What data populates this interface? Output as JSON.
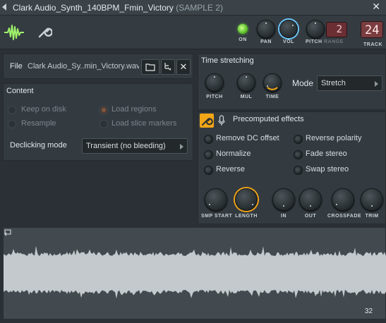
{
  "window": {
    "title": "Clark Audio_Synth_140BPM_Fmin_Victory",
    "subtitle": "(SAMPLE 2)"
  },
  "toolbar": {
    "on_label": "ON",
    "pan_label": "PAN",
    "vol_label": "VOL",
    "pitch_label": "PITCH",
    "range_label": "RANGE",
    "range_value": "2",
    "track_label": "TRACK",
    "track_value": "24"
  },
  "file": {
    "label": "File",
    "name": "Clark Audio_Sy..min_Victory.wav"
  },
  "content": {
    "heading": "Content",
    "keep_on_disk": "Keep on disk",
    "resample": "Resample",
    "load_regions": "Load regions",
    "load_slice_markers": "Load slice markers",
    "declicking_label": "Declicking mode",
    "declicking_value": "Transient (no bleeding)"
  },
  "time_stretching": {
    "heading": "Time stretching",
    "pitch_label": "PITCH",
    "mul_label": "MUL",
    "time_label": "TIME",
    "mode_label": "Mode",
    "mode_value": "Stretch"
  },
  "precomputed": {
    "heading": "Precomputed effects",
    "remove_dc": "Remove DC offset",
    "normalize": "Normalize",
    "reverse": "Reverse",
    "reverse_polarity": "Reverse polarity",
    "fade_stereo": "Fade stereo",
    "swap_stereo": "Swap stereo",
    "smp_start": "SMP START",
    "length": "LENGTH",
    "in": "IN",
    "out": "OUT",
    "crossfade": "CROSSFADE",
    "trim": "TRIM"
  },
  "waveform": {
    "count": "32"
  },
  "colors": {
    "accent_orange": "#f2a516",
    "accent_blue": "#6cc8ff",
    "led_green": "#5cc22a",
    "waveform": "#c3c9cc"
  }
}
